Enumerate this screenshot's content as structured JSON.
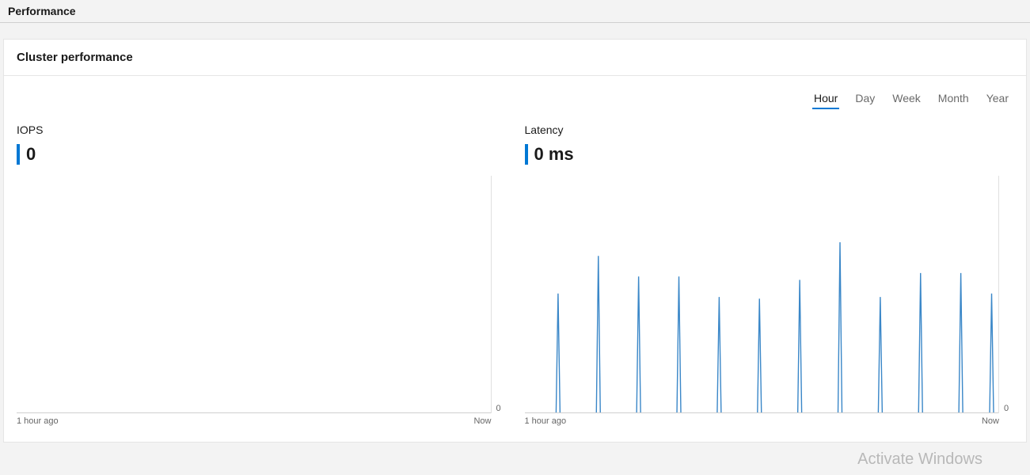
{
  "header": {
    "title": "Performance"
  },
  "panel": {
    "title": "Cluster performance",
    "timeTabs": [
      "Hour",
      "Day",
      "Week",
      "Month",
      "Year"
    ],
    "activeTab": "Hour"
  },
  "iops": {
    "label": "IOPS",
    "value": "0",
    "xStart": "1 hour ago",
    "xEnd": "Now",
    "yBaseline": "0"
  },
  "latency": {
    "label": "Latency",
    "value": "0 ms",
    "xStart": "1 hour ago",
    "xEnd": "Now",
    "yBaseline": "0"
  },
  "watermark": "Activate Windows",
  "chart_data": [
    {
      "type": "line",
      "title": "IOPS",
      "xlabel": "",
      "ylabel": "",
      "xrange": [
        "1 hour ago",
        "Now"
      ],
      "ylim": [
        0,
        1
      ],
      "series": [
        {
          "name": "IOPS",
          "x_fraction": [],
          "values": []
        }
      ],
      "note": "No visible data spikes; value is 0 across the whole interval."
    },
    {
      "type": "line",
      "title": "Latency",
      "xlabel": "",
      "ylabel": "",
      "xrange": [
        "1 hour ago",
        "Now"
      ],
      "ylim": [
        0,
        1
      ],
      "series": [
        {
          "name": "Latency",
          "x_fraction": [
            0.07,
            0.155,
            0.24,
            0.325,
            0.41,
            0.495,
            0.58,
            0.665,
            0.75,
            0.835,
            0.92,
            0.985
          ],
          "values_relative": [
            0.7,
            0.92,
            0.8,
            0.8,
            0.68,
            0.67,
            0.78,
            1.0,
            0.68,
            0.82,
            0.82,
            0.7
          ]
        }
      ],
      "note": "Axis lacks absolute tick labels; spike heights are given relative to the tallest spike (=1.0). Between spikes the value is 0."
    }
  ]
}
